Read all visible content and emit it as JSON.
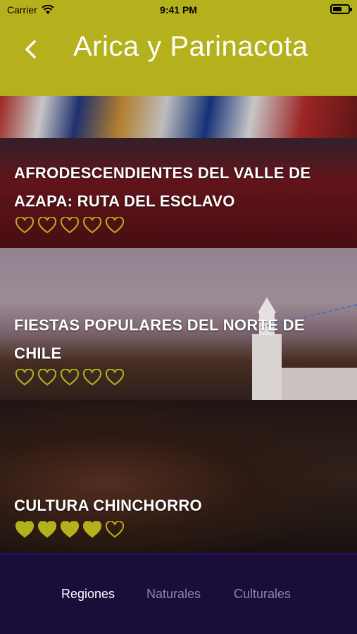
{
  "status_bar": {
    "carrier": "Carrier",
    "time": "9:41 PM"
  },
  "header": {
    "title": "Arica y Parinacota",
    "back_icon": "chevron-left-icon"
  },
  "accent_color": "#b5b11c",
  "cards": [
    {
      "title": "AFRODESCENDIENTES DEL VALLE DE AZAPA: RUTA DEL ESCLAVO",
      "rating": 0,
      "max_rating": 5
    },
    {
      "title": "FIESTAS POPULARES DEL NORTE DE CHILE",
      "rating": 0,
      "max_rating": 5
    },
    {
      "title": "CULTURA CHINCHORRO",
      "rating": 4,
      "max_rating": 5
    }
  ],
  "tabs": [
    {
      "label": "Regiones",
      "active": true
    },
    {
      "label": "Naturales",
      "active": false
    },
    {
      "label": "Culturales",
      "active": false
    }
  ]
}
